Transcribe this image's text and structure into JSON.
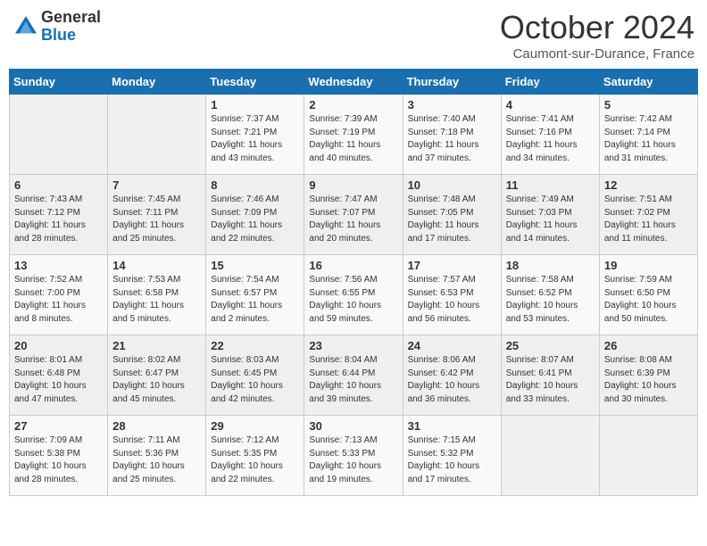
{
  "header": {
    "logo_general": "General",
    "logo_blue": "Blue",
    "month_title": "October 2024",
    "location": "Caumont-sur-Durance, France"
  },
  "days_of_week": [
    "Sunday",
    "Monday",
    "Tuesday",
    "Wednesday",
    "Thursday",
    "Friday",
    "Saturday"
  ],
  "weeks": [
    [
      {
        "day": "",
        "sunrise": "",
        "sunset": "",
        "daylight": ""
      },
      {
        "day": "",
        "sunrise": "",
        "sunset": "",
        "daylight": ""
      },
      {
        "day": "1",
        "sunrise": "Sunrise: 7:37 AM",
        "sunset": "Sunset: 7:21 PM",
        "daylight": "Daylight: 11 hours and 43 minutes."
      },
      {
        "day": "2",
        "sunrise": "Sunrise: 7:39 AM",
        "sunset": "Sunset: 7:19 PM",
        "daylight": "Daylight: 11 hours and 40 minutes."
      },
      {
        "day": "3",
        "sunrise": "Sunrise: 7:40 AM",
        "sunset": "Sunset: 7:18 PM",
        "daylight": "Daylight: 11 hours and 37 minutes."
      },
      {
        "day": "4",
        "sunrise": "Sunrise: 7:41 AM",
        "sunset": "Sunset: 7:16 PM",
        "daylight": "Daylight: 11 hours and 34 minutes."
      },
      {
        "day": "5",
        "sunrise": "Sunrise: 7:42 AM",
        "sunset": "Sunset: 7:14 PM",
        "daylight": "Daylight: 11 hours and 31 minutes."
      }
    ],
    [
      {
        "day": "6",
        "sunrise": "Sunrise: 7:43 AM",
        "sunset": "Sunset: 7:12 PM",
        "daylight": "Daylight: 11 hours and 28 minutes."
      },
      {
        "day": "7",
        "sunrise": "Sunrise: 7:45 AM",
        "sunset": "Sunset: 7:11 PM",
        "daylight": "Daylight: 11 hours and 25 minutes."
      },
      {
        "day": "8",
        "sunrise": "Sunrise: 7:46 AM",
        "sunset": "Sunset: 7:09 PM",
        "daylight": "Daylight: 11 hours and 22 minutes."
      },
      {
        "day": "9",
        "sunrise": "Sunrise: 7:47 AM",
        "sunset": "Sunset: 7:07 PM",
        "daylight": "Daylight: 11 hours and 20 minutes."
      },
      {
        "day": "10",
        "sunrise": "Sunrise: 7:48 AM",
        "sunset": "Sunset: 7:05 PM",
        "daylight": "Daylight: 11 hours and 17 minutes."
      },
      {
        "day": "11",
        "sunrise": "Sunrise: 7:49 AM",
        "sunset": "Sunset: 7:03 PM",
        "daylight": "Daylight: 11 hours and 14 minutes."
      },
      {
        "day": "12",
        "sunrise": "Sunrise: 7:51 AM",
        "sunset": "Sunset: 7:02 PM",
        "daylight": "Daylight: 11 hours and 11 minutes."
      }
    ],
    [
      {
        "day": "13",
        "sunrise": "Sunrise: 7:52 AM",
        "sunset": "Sunset: 7:00 PM",
        "daylight": "Daylight: 11 hours and 8 minutes."
      },
      {
        "day": "14",
        "sunrise": "Sunrise: 7:53 AM",
        "sunset": "Sunset: 6:58 PM",
        "daylight": "Daylight: 11 hours and 5 minutes."
      },
      {
        "day": "15",
        "sunrise": "Sunrise: 7:54 AM",
        "sunset": "Sunset: 6:57 PM",
        "daylight": "Daylight: 11 hours and 2 minutes."
      },
      {
        "day": "16",
        "sunrise": "Sunrise: 7:56 AM",
        "sunset": "Sunset: 6:55 PM",
        "daylight": "Daylight: 10 hours and 59 minutes."
      },
      {
        "day": "17",
        "sunrise": "Sunrise: 7:57 AM",
        "sunset": "Sunset: 6:53 PM",
        "daylight": "Daylight: 10 hours and 56 minutes."
      },
      {
        "day": "18",
        "sunrise": "Sunrise: 7:58 AM",
        "sunset": "Sunset: 6:52 PM",
        "daylight": "Daylight: 10 hours and 53 minutes."
      },
      {
        "day": "19",
        "sunrise": "Sunrise: 7:59 AM",
        "sunset": "Sunset: 6:50 PM",
        "daylight": "Daylight: 10 hours and 50 minutes."
      }
    ],
    [
      {
        "day": "20",
        "sunrise": "Sunrise: 8:01 AM",
        "sunset": "Sunset: 6:48 PM",
        "daylight": "Daylight: 10 hours and 47 minutes."
      },
      {
        "day": "21",
        "sunrise": "Sunrise: 8:02 AM",
        "sunset": "Sunset: 6:47 PM",
        "daylight": "Daylight: 10 hours and 45 minutes."
      },
      {
        "day": "22",
        "sunrise": "Sunrise: 8:03 AM",
        "sunset": "Sunset: 6:45 PM",
        "daylight": "Daylight: 10 hours and 42 minutes."
      },
      {
        "day": "23",
        "sunrise": "Sunrise: 8:04 AM",
        "sunset": "Sunset: 6:44 PM",
        "daylight": "Daylight: 10 hours and 39 minutes."
      },
      {
        "day": "24",
        "sunrise": "Sunrise: 8:06 AM",
        "sunset": "Sunset: 6:42 PM",
        "daylight": "Daylight: 10 hours and 36 minutes."
      },
      {
        "day": "25",
        "sunrise": "Sunrise: 8:07 AM",
        "sunset": "Sunset: 6:41 PM",
        "daylight": "Daylight: 10 hours and 33 minutes."
      },
      {
        "day": "26",
        "sunrise": "Sunrise: 8:08 AM",
        "sunset": "Sunset: 6:39 PM",
        "daylight": "Daylight: 10 hours and 30 minutes."
      }
    ],
    [
      {
        "day": "27",
        "sunrise": "Sunrise: 7:09 AM",
        "sunset": "Sunset: 5:38 PM",
        "daylight": "Daylight: 10 hours and 28 minutes."
      },
      {
        "day": "28",
        "sunrise": "Sunrise: 7:11 AM",
        "sunset": "Sunset: 5:36 PM",
        "daylight": "Daylight: 10 hours and 25 minutes."
      },
      {
        "day": "29",
        "sunrise": "Sunrise: 7:12 AM",
        "sunset": "Sunset: 5:35 PM",
        "daylight": "Daylight: 10 hours and 22 minutes."
      },
      {
        "day": "30",
        "sunrise": "Sunrise: 7:13 AM",
        "sunset": "Sunset: 5:33 PM",
        "daylight": "Daylight: 10 hours and 19 minutes."
      },
      {
        "day": "31",
        "sunrise": "Sunrise: 7:15 AM",
        "sunset": "Sunset: 5:32 PM",
        "daylight": "Daylight: 10 hours and 17 minutes."
      },
      {
        "day": "",
        "sunrise": "",
        "sunset": "",
        "daylight": ""
      },
      {
        "day": "",
        "sunrise": "",
        "sunset": "",
        "daylight": ""
      }
    ]
  ]
}
